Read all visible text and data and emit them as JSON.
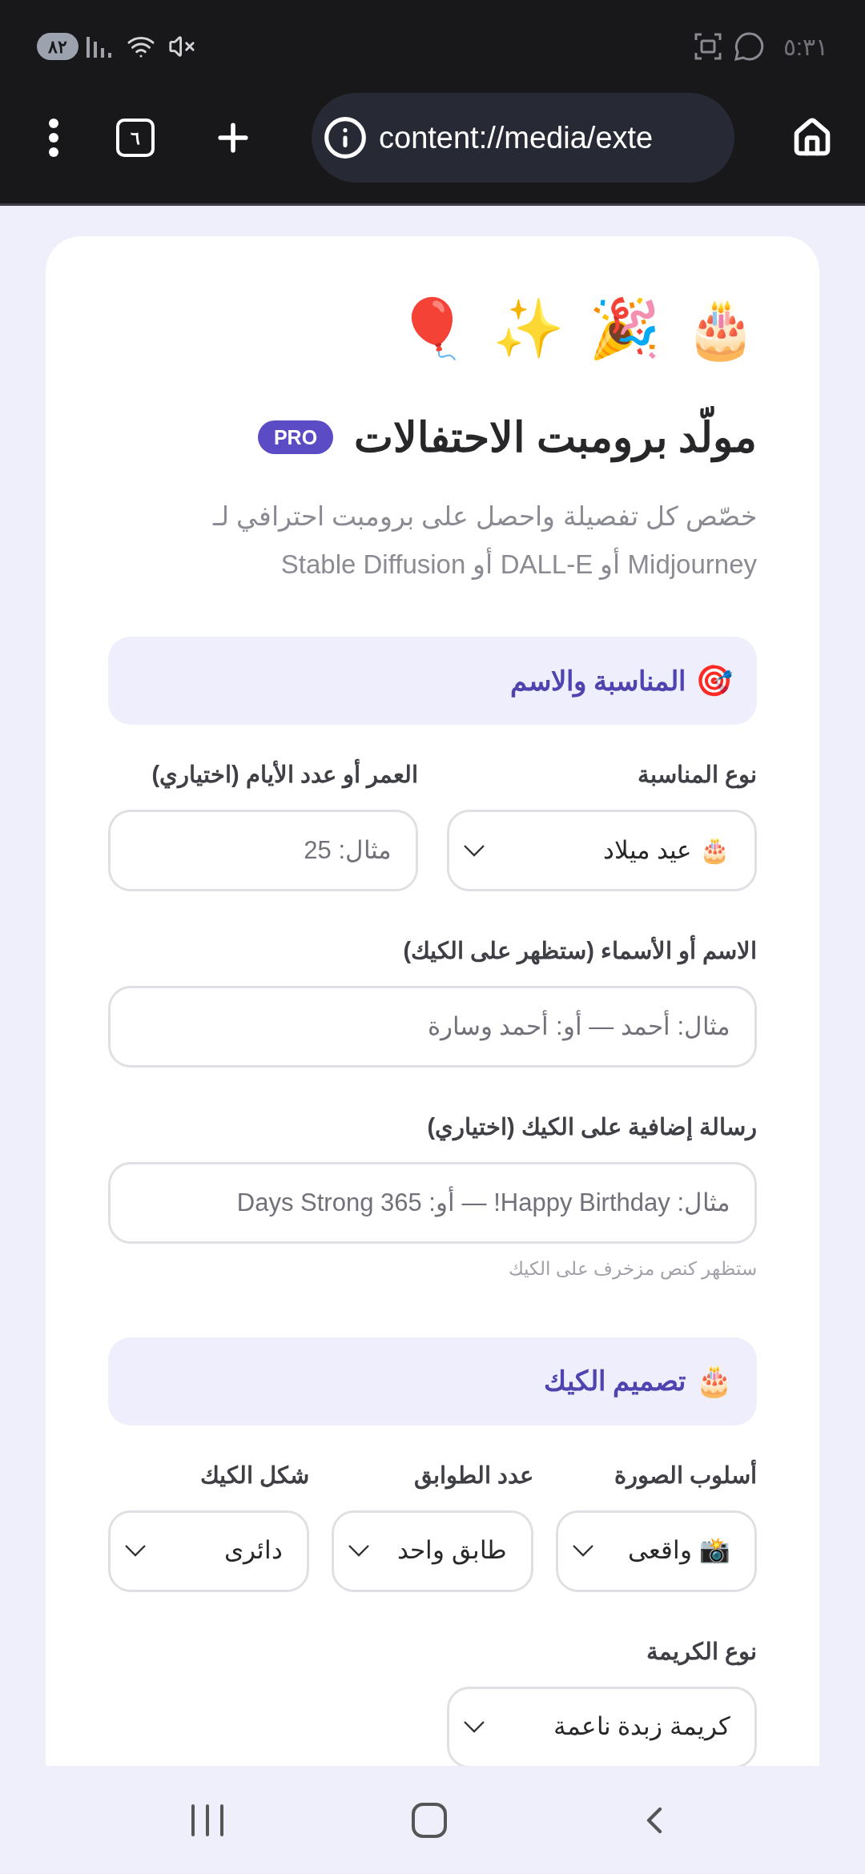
{
  "status_bar": {
    "battery": "٨٢",
    "time": "٥:٣١"
  },
  "browser": {
    "tab_count": "٦",
    "url": "content://media/exte"
  },
  "header": {
    "emojis": [
      "🎂",
      "🎉",
      "✨",
      "🎈"
    ],
    "title": "مولّد برومبت الاحتفالات",
    "badge": "PRO",
    "subtitle": "خصّص كل تفصيلة واحصل على برومبت احترافي لـ Midjourney أو DALL-E أو Stable Diffusion"
  },
  "sections": [
    {
      "icon": "🎯",
      "title": "المناسبة والاسم",
      "rows": [
        {
          "fields": [
            {
              "kind": "select",
              "label": "نوع المناسبة",
              "value": "🎂 عيد ميلاد"
            },
            {
              "kind": "input",
              "label": "العمر أو عدد الأيام (اختياري)",
              "placeholder": "مثال: 25"
            }
          ]
        },
        {
          "fields": [
            {
              "kind": "input",
              "label": "الاسم أو الأسماء (ستظهر على الكيك)",
              "placeholder": "مثال: أحمد — أو: أحمد وسارة"
            }
          ]
        },
        {
          "fields": [
            {
              "kind": "input",
              "label": "رسالة إضافية على الكيك (اختياري)",
              "placeholder": "مثال: Happy Birthday! — أو: 365 Days Strong",
              "hint": "ستظهر كنص مزخرف على الكيك"
            }
          ]
        }
      ]
    },
    {
      "icon": "🎂",
      "title": "تصميم الكيك",
      "rows": [
        {
          "fields": [
            {
              "kind": "select",
              "label": "أسلوب الصورة",
              "value": "📸 واقعى"
            },
            {
              "kind": "select",
              "label": "عدد الطوابق",
              "value": "طابق واحد"
            },
            {
              "kind": "select",
              "label": "شكل الكيك",
              "value": "دائرى"
            }
          ]
        },
        {
          "fields": [
            {
              "kind": "select",
              "label": "نوع الكريمة",
              "value": "كريمة زبدة ناعمة"
            }
          ]
        }
      ]
    }
  ]
}
